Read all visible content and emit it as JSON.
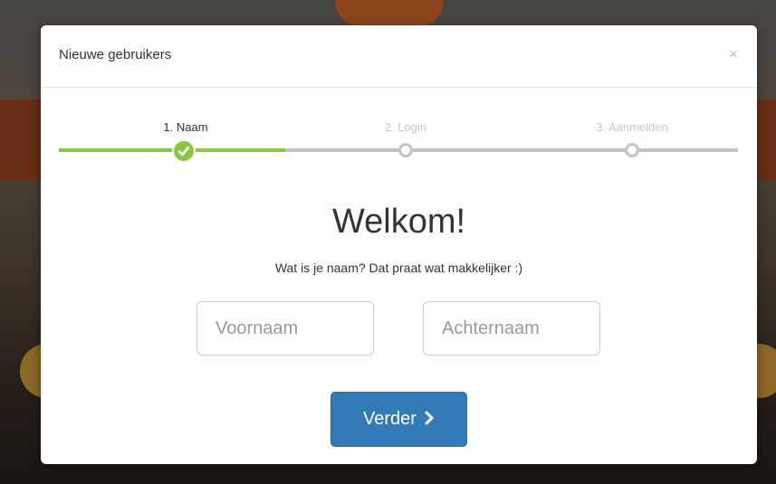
{
  "modal": {
    "title": "Nieuwe gebruikers",
    "close_label": "×"
  },
  "steps": [
    {
      "label": "1. Naam",
      "state": "done"
    },
    {
      "label": "2. Login",
      "state": "pending"
    },
    {
      "label": "3. Aanmelden",
      "state": "pending"
    }
  ],
  "progress": {
    "completed_steps": 1,
    "total_steps": 3,
    "fraction": 0.333
  },
  "content": {
    "heading": "Welkom!",
    "subtext": "Wat is je naam? Dat praat wat makkelijker :)"
  },
  "form": {
    "first_name": {
      "value": "",
      "placeholder": "Voornaam"
    },
    "last_name": {
      "value": "",
      "placeholder": "Achternaam"
    }
  },
  "actions": {
    "next_label": "Verder"
  },
  "colors": {
    "accent_green": "#8dc63f",
    "primary_blue": "#337ab7",
    "inactive_gray": "#c4c4c4"
  },
  "icons": {
    "step_done": "check-icon",
    "next": "chevron-right-icon",
    "close": "close-icon"
  }
}
